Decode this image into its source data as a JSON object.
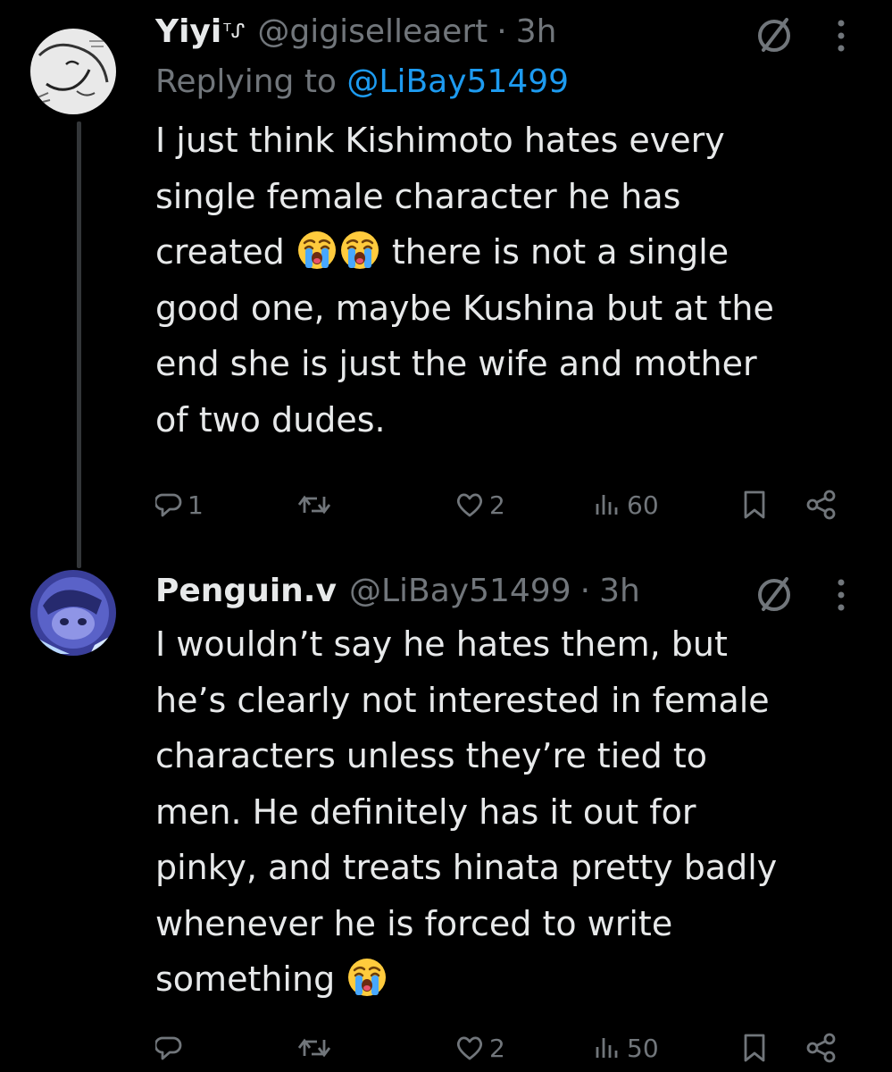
{
  "tweets": [
    {
      "display_name": "Yiyi",
      "name_suffix": "ᵀᔑ",
      "handle": "@gigiselleaert",
      "separator": "·",
      "time": "3h",
      "replying_prefix": "Replying to",
      "replying_handle": "@LiBay51499",
      "lines": [
        [
          "I just think Kishimoto hates every"
        ],
        [
          "single female character he has"
        ],
        [
          "created ",
          "EMOJI",
          "EMOJI",
          " there is not a single"
        ],
        [
          "good one, maybe Kushina but at the"
        ],
        [
          "end she is just the wife and mother"
        ],
        [
          "of two dudes."
        ]
      ],
      "line_texts": {
        "l1": "I just think Kishimoto hates every",
        "l2": "single female character he has",
        "l3a": "created ",
        "l3b": " there is not a single",
        "l4": "good one, maybe Kushina but at the",
        "l5": "end she is just the wife and mother",
        "l6": "of two dudes."
      },
      "emoji": "loudly-crying-face",
      "stats": {
        "replies": "1",
        "retweets": "",
        "likes": "2",
        "views": "60"
      }
    },
    {
      "display_name": "Penguin.v",
      "handle": "@LiBay51499",
      "separator": "·",
      "time": "3h",
      "line_texts": {
        "l1": "I wouldn’t say he hates them, but",
        "l2": "he’s clearly not interested in female",
        "l3": "characters unless they’re tied to",
        "l4": "men. He definitely has it out for",
        "l5": "pinky, and treats hinata pretty badly",
        "l6": "whenever he is forced to write",
        "l7": "something "
      },
      "emoji": "loudly-crying-face",
      "stats": {
        "replies": "",
        "retweets": "",
        "likes": "2",
        "views": "50"
      }
    }
  ],
  "colors": {
    "background": "#000000",
    "text": "#e7e9ea",
    "secondary": "#71767b",
    "link": "#1d9bf0",
    "thread_line": "#333639"
  },
  "icons": [
    "reply-icon",
    "retweet-icon",
    "like-icon",
    "views-icon",
    "bookmark-icon",
    "share-icon",
    "nosign-icon",
    "more-icon"
  ]
}
